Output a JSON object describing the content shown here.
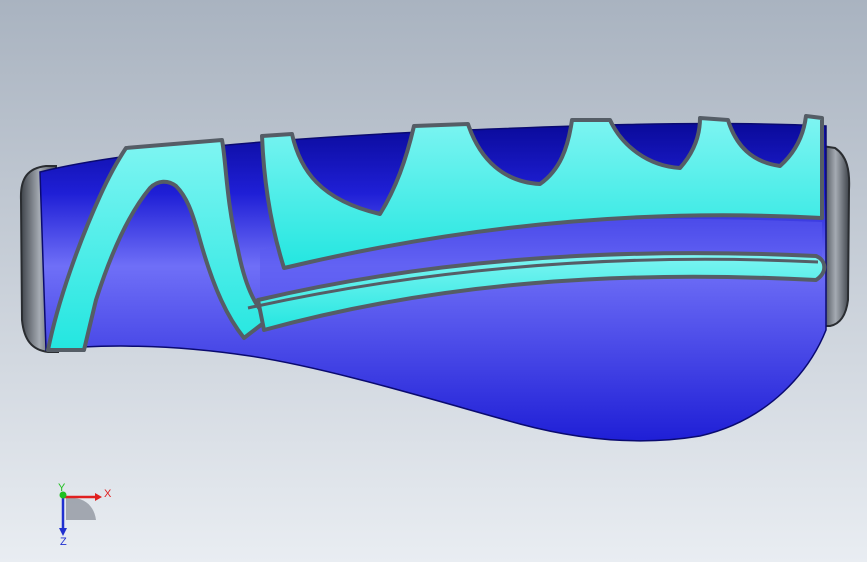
{
  "viewport": {
    "background_top": "#a9b3c0",
    "background_bottom": "#e9edf2"
  },
  "model": {
    "body_color": "#1f1fd6",
    "body_highlight": "#6f6ff7",
    "body_shadow": "#0a0a9a",
    "grip_color": "#23e6e0",
    "grip_highlight": "#7ff5f2",
    "groove_color": "#555d66",
    "cap_color": "#3e434a",
    "cap_highlight": "#a5abb3"
  },
  "triad": {
    "x_label": "X",
    "y_label": "Y",
    "z_label": "Z",
    "x_color": "#e02020",
    "y_color": "#20c020",
    "z_color": "#2030d0"
  }
}
